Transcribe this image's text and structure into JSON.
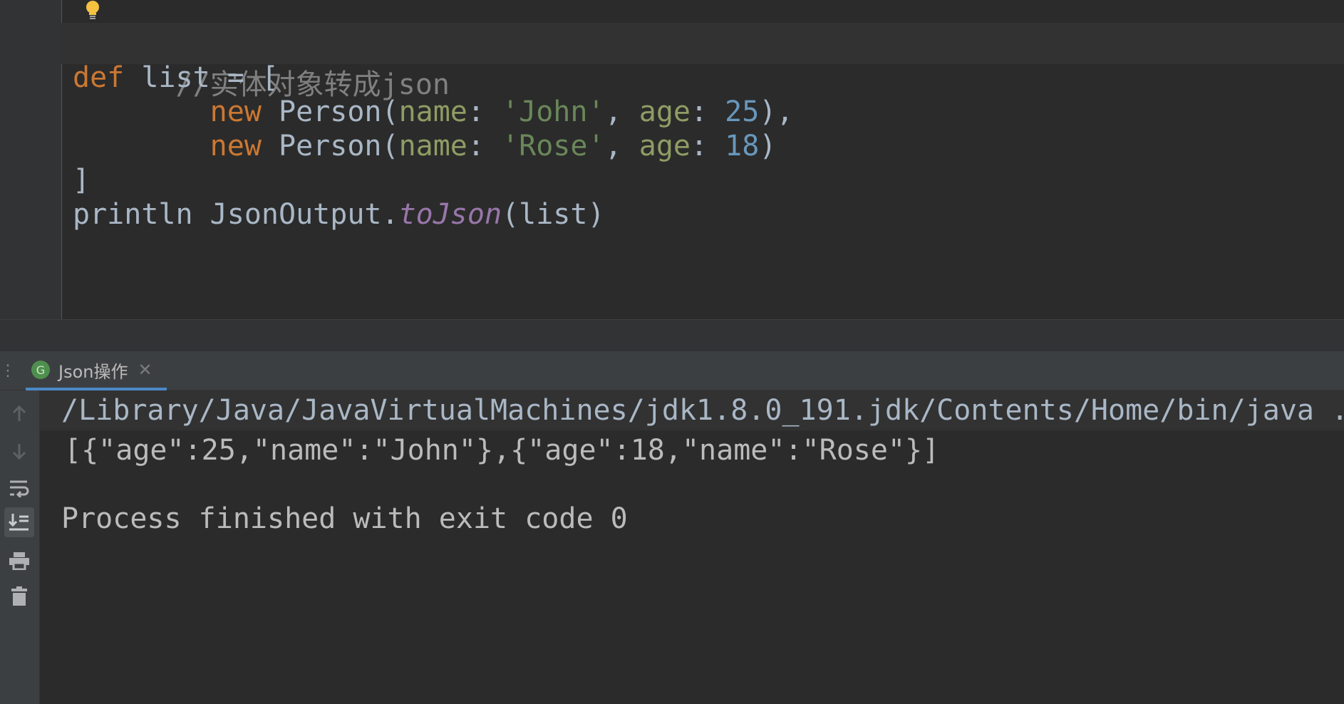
{
  "editor": {
    "lines": [
      {
        "comment": "//实体对象转成json"
      },
      {
        "kw": "def",
        "rest": " list = ["
      },
      {
        "indent": "        ",
        "kw": "new",
        "cls": " Person(",
        "p1": "name",
        "c1": ": ",
        "s1": "'John'",
        "sep": ", ",
        "p2": "age",
        "c2": ": ",
        "n1": "25",
        "end": "),"
      },
      {
        "indent": "        ",
        "kw": "new",
        "cls": " Person(",
        "p1": "name",
        "c1": ": ",
        "s1": "'Rose'",
        "sep": ", ",
        "p2": "age",
        "c2": ": ",
        "n1": "18",
        "end": ")"
      },
      {
        "plain": "]"
      },
      {
        "plain1": "println JsonOutput.",
        "static": "toJson",
        "plain2": "(list)"
      }
    ]
  },
  "run_window": {
    "tab_label": "Json操作",
    "tab_icon_letter": "G",
    "tab_close": "✕",
    "console": {
      "command": "/Library/Java/JavaVirtualMachines/jdk1.8.0_191.jdk/Contents/Home/bin/java ...",
      "output": "[{\"age\":25,\"name\":\"John\"},{\"age\":18,\"name\":\"Rose\"}]",
      "process_message": "Process finished with exit code 0"
    },
    "toolbar_icons": [
      "up-arrow-icon",
      "down-arrow-icon",
      "soft-wrap-icon",
      "scroll-to-end-icon",
      "print-icon",
      "trash-icon"
    ]
  },
  "colors": {
    "keyword": "#cc7832",
    "string": "#6a8759",
    "number": "#6897bb",
    "static_method": "#9876aa",
    "comment": "#808080",
    "text": "#a9b7c6"
  }
}
